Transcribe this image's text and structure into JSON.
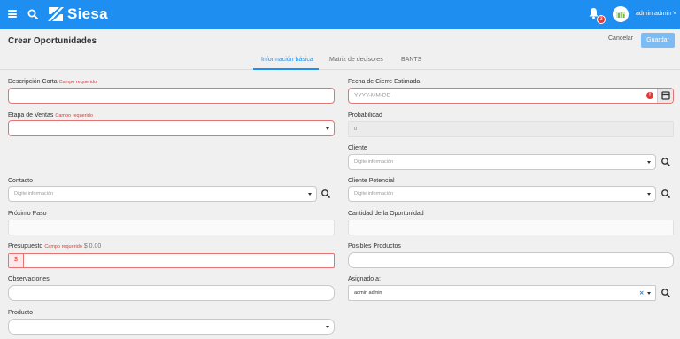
{
  "header": {
    "logo_text": "Siesa",
    "notification_count": "3",
    "user_label": "admin admin ˅"
  },
  "page": {
    "title": "Crear Oportunidades",
    "cancel_label": "Cancelar",
    "save_label": "Guardar"
  },
  "tabs": [
    {
      "label": "Información básica",
      "active": true
    },
    {
      "label": "Matriz de decisores",
      "active": false
    },
    {
      "label": "BANTS",
      "active": false
    }
  ],
  "form": {
    "required_text": "Campo requerido",
    "descripcion_label": "Descripción Corta",
    "etapa_label": "Etapa de Ventas",
    "contacto_label": "Contacto",
    "contacto_placeholder": "Digite información",
    "proximo_label": "Próximo Paso",
    "presupuesto_label": "Presupuesto",
    "presupuesto_amount": "$ 0.00",
    "currency_symbol": "$",
    "observaciones_label": "Observaciones",
    "producto_label": "Producto",
    "fecha_label": "Fecha de Cierre Estimada",
    "fecha_placeholder": "YYYY-MM-DD",
    "probabilidad_label": "Probabilidad",
    "probabilidad_value": "0",
    "cliente_label": "Cliente",
    "cliente_placeholder": "Digite información",
    "cliente_potencial_label": "Cliente Potencial",
    "cliente_potencial_placeholder": "Digite información",
    "cantidad_label": "Cantidad de la Oportunidad",
    "posibles_label": "Posibles Productos",
    "asignado_label": "Asignado a:",
    "asignado_value": "admin admin"
  },
  "colors": {
    "brand": "#1f8ef1",
    "error": "#e53935"
  }
}
